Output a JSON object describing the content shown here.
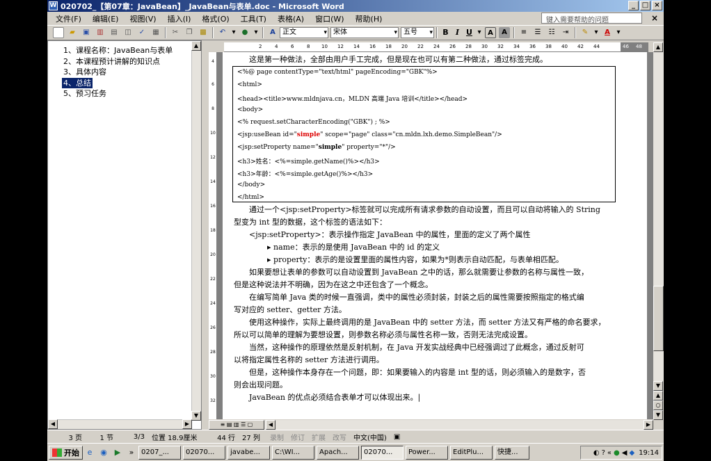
{
  "window": {
    "title": "020702_【第07章：JavaBean】_JavaBean与表单.doc - Microsoft Word",
    "buttons": {
      "minimize": "_",
      "maximize": "□",
      "close": "×"
    }
  },
  "menubar": {
    "items": [
      "文件(F)",
      "编辑(E)",
      "视图(V)",
      "插入(I)",
      "格式(O)",
      "工具(T)",
      "表格(A)",
      "窗口(W)",
      "帮助(H)"
    ],
    "help_placeholder": "键入需要帮助的问题"
  },
  "toolbar": {
    "style": "正文",
    "font": "宋体",
    "size": "五号",
    "fmt": {
      "bold": "B",
      "italic": "I",
      "underline": "U"
    }
  },
  "nav_pane": {
    "items": [
      "1、课程名称：JavaBean与表单",
      "2、本课程预计讲解的知识点",
      "3、具体内容",
      "4、总结",
      "5、预习任务"
    ],
    "selected": 3
  },
  "ruler": {
    "h_ticks": [
      "2",
      "4",
      "6",
      "8",
      "10",
      "12",
      "14",
      "16",
      "18",
      "20",
      "22",
      "24",
      "26",
      "28",
      "30",
      "32",
      "34",
      "36",
      "38",
      "40",
      "42",
      "44",
      "46",
      "48"
    ],
    "v_ticks": [
      "4",
      "6",
      "8",
      "10",
      "12",
      "14",
      "16",
      "18",
      "20",
      "22",
      "24",
      "26",
      "28",
      "30",
      "32"
    ]
  },
  "document": {
    "intro": "这是第一种做法，全部由用户手工完成，但是现在也可以有第二种做法，通过标签完成。",
    "code": {
      "l1": "<%@ page contentType=\"text/html\" pageEncoding=\"GBK\"%>",
      "l2": "<html>",
      "l3": "<head><title>www.mldnjava.cn，MLDN 高端 Java 培训</title></head>",
      "l4": "<body>",
      "l5": "<%    request.setCharacterEncoding(\"GBK\") ; %>",
      "l6a": "<jsp:useBean id=\"",
      "l6b": "simple",
      "l6c": "\" scope=\"page\" class=\"cn.mldn.lxh.demo.SimpleBean\"/>",
      "l7a": "<jsp:setProperty name=\"",
      "l7b": "simple",
      "l7c": "\" property=\"*\"/>",
      "l8": "<h3>姓名：<%=simple.getName()%></h3>",
      "l9": "<h3>年龄：<%=simple.getAge()%></h3>",
      "l10": "</body>",
      "l11": "</html>"
    },
    "p1": "通过一个<jsp:setProperty>标签就可以完成所有请求参数的自动设置，而且可以自动将输入的  String",
    "p1b": "型变为 int  型的数据，这个标签的语法如下：",
    "p2": "<jsp:setProperty>：表示操作指定 JavaBean 中的属性，里面的定义了两个属性",
    "p3": "name：表示的是使用 JavaBean 中的 id 的定义",
    "p4": "property：表示的是设置里面的属性内容，如果为*则表示自动匹配，与表单相匹配。",
    "p5": "如果要想让表单的参数可以自动设置到 JavaBean 之中的话，那么就需要让参数的名称与属性一致，",
    "p5b": "但是这种说法并不明确，因为在这之中还包含了一个概念。",
    "p6": "在编写简单 Java 类的时候一直强调，类中的属性必须封装，封装之后的属性需要按照指定的格式编",
    "p6b": "写对应的 setter、getter 方法。",
    "p7": "使用这种操作，实际上最终调用的是 JavaBean 中的 setter 方法，而 setter 方法又有严格的命名要求，",
    "p7b": "所以可以简单的理解为要想设置，则参数名称必须与属性名称一致，否则无法完成设置。",
    "p8": "当然，这种操作的原理依然是反射机制，在 Java 开发实战经典中已经强调过了此概念，通过反射可",
    "p8b": "以将指定属性名称的  setter 方法进行调用。",
    "p9": "但是，这种操作本身存在一个问题，即：如果要输入的内容是 int 型的话，则必须输入的是数字，否",
    "p9b": "则会出现问题。",
    "p10": "JavaBean 的优点必须结合表单才可以体现出来。"
  },
  "status": {
    "page": "3 页",
    "section": "1 节",
    "count": "3/3",
    "position": "位置 18.9厘米",
    "line": "44 行",
    "column": "27 列",
    "rec": "录制",
    "trk": "修订",
    "ext": "扩展",
    "ovr": "改写",
    "lang": "中文(中国)"
  },
  "taskbar": {
    "start": "开始",
    "tasks": [
      "0207_...",
      "02070...",
      "javabe...",
      "C:\\WI...",
      "Apach...",
      "02070...",
      "Power...",
      "EditPlu...",
      "快捷..."
    ],
    "active": 5,
    "clock": "19:14"
  }
}
